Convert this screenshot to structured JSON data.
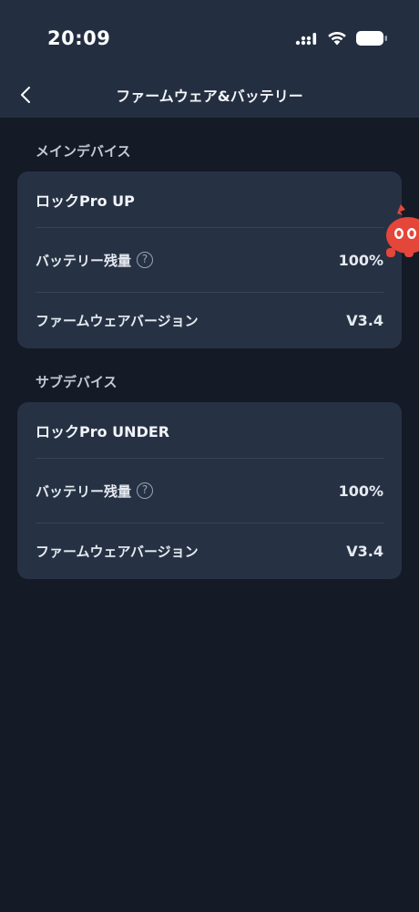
{
  "status_bar": {
    "time": "20:09"
  },
  "nav": {
    "title": "ファームウェア&バッテリー"
  },
  "sections": [
    {
      "title": "メインデバイス",
      "device_name": "ロックPro UP",
      "battery_label": "バッテリー残量",
      "battery_value": "100%",
      "firmware_label": "ファームウェアバージョン",
      "firmware_value": "V3.4"
    },
    {
      "title": "サブデバイス",
      "device_name": "ロックPro UNDER",
      "battery_label": "バッテリー残量",
      "battery_value": "100%",
      "firmware_label": "ファームウェアバージョン",
      "firmware_value": "V3.4"
    }
  ],
  "help_icon_glyph": "?",
  "colors": {
    "background": "#141a26",
    "card": "#263244",
    "header": "#232e40",
    "mascot": "#e5463a"
  }
}
